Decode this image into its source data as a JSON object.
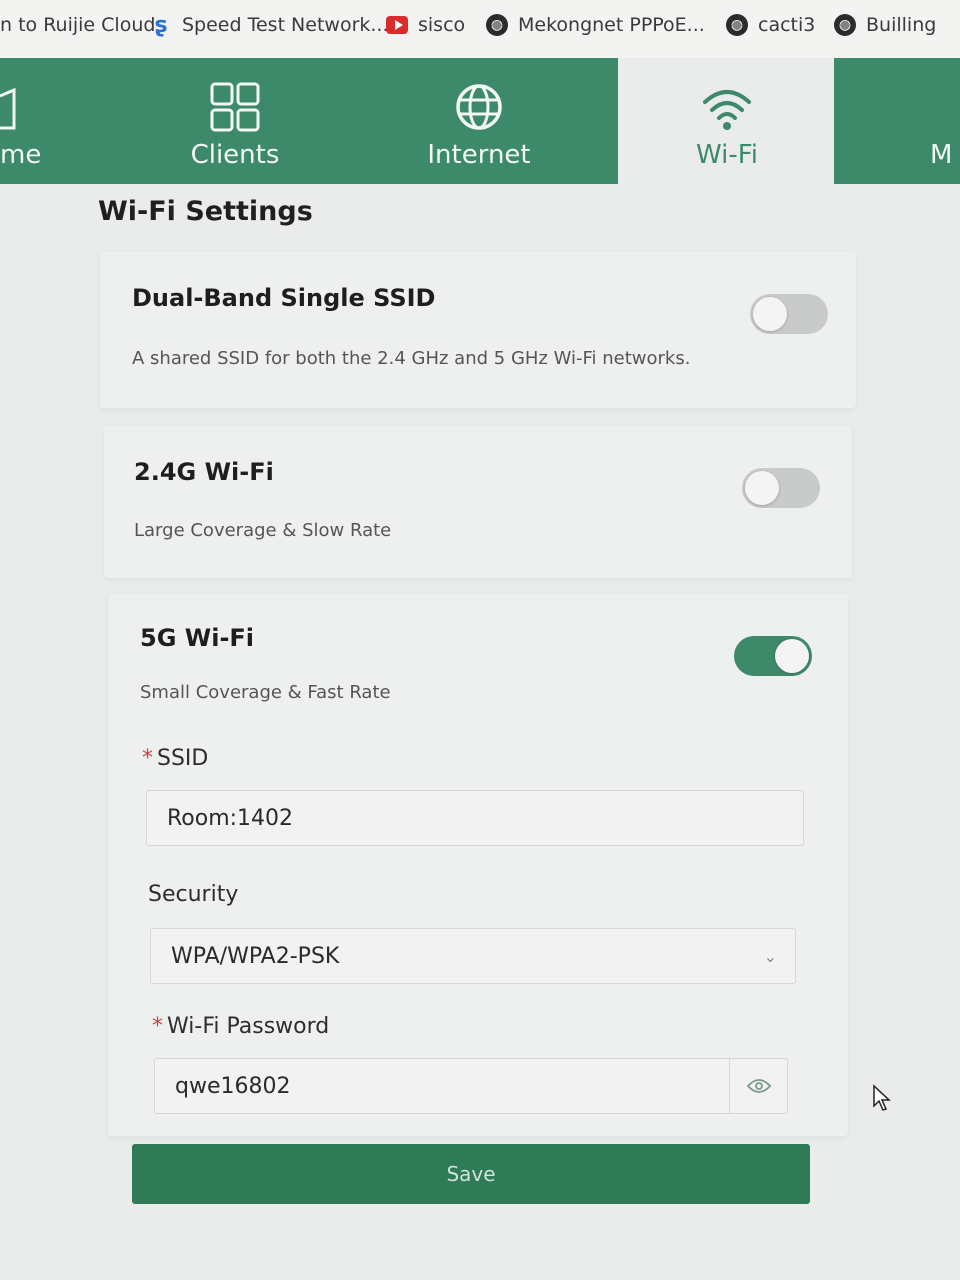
{
  "bookmarks": [
    {
      "label": "n to Ruijie Cloud",
      "icon": "none"
    },
    {
      "label": "Speed Test Network...",
      "icon": "speedtest-icon"
    },
    {
      "label": "sisco",
      "icon": "youtube-icon"
    },
    {
      "label": "Mekongnet PPPoE...",
      "icon": "globe-icon"
    },
    {
      "label": "cacti3",
      "icon": "globe-icon"
    },
    {
      "label": "Builling",
      "icon": "globe-icon"
    }
  ],
  "nav": {
    "home": "me",
    "clients": "Clients",
    "internet": "Internet",
    "wifi": "Wi-Fi",
    "more": "M"
  },
  "page_title": "Wi-Fi Settings",
  "dual_band": {
    "title": "Dual-Band Single SSID",
    "desc": "A shared SSID for both the 2.4 GHz and 5 GHz Wi-Fi networks.",
    "enabled": false
  },
  "wifi_24": {
    "title": "2.4G Wi-Fi",
    "desc": "Large Coverage & Slow Rate",
    "enabled": false
  },
  "wifi_5": {
    "title": "5G Wi-Fi",
    "desc": "Small Coverage & Fast Rate",
    "enabled": true,
    "ssid_label": "SSID",
    "ssid_value": "Room:1402",
    "security_label": "Security",
    "security_value": "WPA/WPA2-PSK",
    "password_label": "Wi-Fi Password",
    "password_value": "qwe16802",
    "required_mark": "*"
  },
  "save_label": "Save",
  "colors": {
    "accent": "#3d8a6a",
    "button": "#2f7a57"
  }
}
